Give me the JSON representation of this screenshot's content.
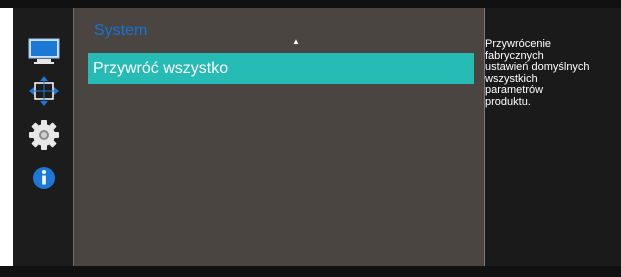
{
  "sidebar": {
    "items": [
      {
        "icon": "monitor-icon"
      },
      {
        "icon": "position-arrows-icon"
      },
      {
        "icon": "gear-icon"
      },
      {
        "icon": "info-icon"
      }
    ]
  },
  "main": {
    "title": "System",
    "scroll_up_glyph": "▲",
    "menu_items": [
      {
        "label": "Przywróć wszystko",
        "selected": true
      }
    ]
  },
  "help": {
    "text": "Przywrócenie\nfabrycznych\nustawień domyślnych\nwszystkich\nparametrów\nproduktu."
  },
  "colors": {
    "accent_title": "#1473d6",
    "highlight": "#27bbb6",
    "panel_bg": "#4b4542",
    "sidebar_bg": "#1c1c1c"
  }
}
